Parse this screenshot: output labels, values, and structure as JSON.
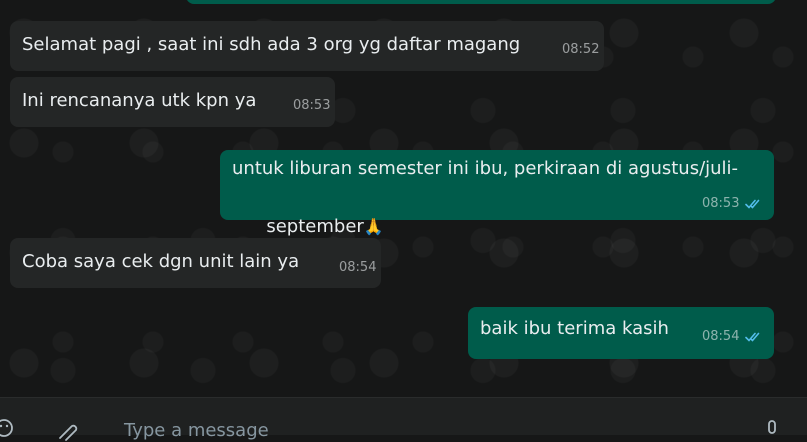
{
  "messages": [
    {
      "text": "Selamat pagi , saat ini sdh ada 3 org yg daftar magang",
      "time": "08:52",
      "direction": "incoming"
    },
    {
      "text": "Ini rencananya utk kpn ya",
      "time": "08:53",
      "direction": "incoming"
    },
    {
      "text_line1": "untuk liburan semester ini ibu, perkiraan di agustus/juli-",
      "text_line2": "september",
      "emoji": "🙏",
      "time": "08:53",
      "direction": "outgoing",
      "status": "read"
    },
    {
      "text": "Coba saya cek dgn unit lain ya",
      "time": "08:54",
      "direction": "incoming"
    },
    {
      "text": "baik ibu terima kasih",
      "time": "08:54",
      "direction": "outgoing",
      "status": "read"
    }
  ],
  "composer": {
    "placeholder": "Type a message",
    "icons": [
      "emoji-icon",
      "attach-icon",
      "microphone-icon"
    ]
  },
  "colors": {
    "incoming_bubble": "#242626",
    "outgoing_bubble": "#005c4b",
    "read_ticks": "#53bdeb",
    "background": "#161717"
  }
}
